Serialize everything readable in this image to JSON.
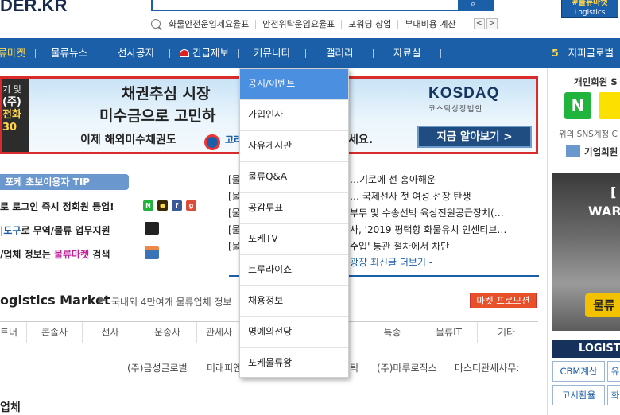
{
  "header": {
    "logo": "DER.KR",
    "search_button": "검색",
    "market_badge_line1": "#물류마켓",
    "market_badge_line2": "Logistics Market",
    "keywords": [
      "화물안전운임제요율표",
      "안전위탁운임요율표",
      "포워딩 창업",
      "부대비용 계산"
    ],
    "prev": "<",
    "next": ">"
  },
  "nav": {
    "items": [
      "물류마켓",
      "물류뉴스",
      "선사공지",
      "긴급제보",
      "커뮤니티",
      "갤러리",
      "자료실"
    ],
    "rank_num": "5",
    "rank_label": "지피글로벌"
  },
  "banner": {
    "left_line1": "기 및",
    "left_line2": "(주)",
    "left_line3": "전화",
    "left_line4": "30",
    "headline1": "채권추심 시장",
    "headline2": "미수금으로 고민하",
    "subline": "이제 해외미수채권도",
    "subline_logo_text": "고리",
    "subline_end": "세요.",
    "kosdaq_main": "KOSDAQ",
    "kosdaq_sub": "코스닥상장법인",
    "cta": "지금 알아보기 >"
  },
  "tip": {
    "badge": "포케 초보이용자 TIP",
    "line1": "로 로그인 즉시 정회원 등업!",
    "line2_blue": "|도구",
    "line2_rest": "로 무역/물류 업무지원",
    "line3_pre": "/업체 정보는 ",
    "line3_mag": "물류마켓",
    "line3_post": " 검색"
  },
  "news": {
    "items": [
      "[물",
      "[물",
      "[물",
      "[물",
      "[물"
    ],
    "items_tail": [
      "…기로에 선 홍아해운",
      "… 국제선사 첫 여성 선장 탄생",
      "부두 및 수송선박 육상전원공급장치(…",
      "사, '2019 평택항 화물유치 인센티브…",
      "수입' 통관 절차에서 차단"
    ],
    "more": "광장 최신글 더보기 -"
  },
  "market": {
    "title": "ogistics Market",
    "subtitle": "국내외 4만여개 물류업체 정보",
    "promo": "마켓 프로모션",
    "categories": [
      "트너",
      "콘솔사",
      "선사",
      "운송사",
      "관세사",
      "",
      "",
      "특송",
      "물류IT",
      "기타"
    ],
    "companies": [
      "(주)금성글로벌",
      "미래피앤",
      "틱",
      "(주)마루로직스",
      "마스터관세사무:"
    ],
    "bottom_heading": "업체"
  },
  "right": {
    "member_label": "개인회원 S",
    "n_label": "N",
    "sns_text": "위의 SNS계정 C",
    "biz_label": "기업회원",
    "ad_t1": "[",
    "ad_t2": "WAR",
    "ad_btn": "물류",
    "logi_label": "LOGIST",
    "btn1": "CBM계산",
    "btn1b": "유",
    "btn2": "고시환율",
    "btn2b": "화"
  },
  "dropdown": {
    "items": [
      "공지/이벤트",
      "가입인사",
      "자유게시판",
      "물류Q&A",
      "공감투표",
      "포케TV",
      "트루라이쇼",
      "채용정보",
      "명예의전당",
      "포케물류왕"
    ],
    "active_index": 0
  },
  "colors": {
    "brand_blue": "#1b5fa8",
    "nav_highlight": "#ffd64a",
    "dropdown_active": "#4a8fe0",
    "promo_red": "#e8502a"
  }
}
